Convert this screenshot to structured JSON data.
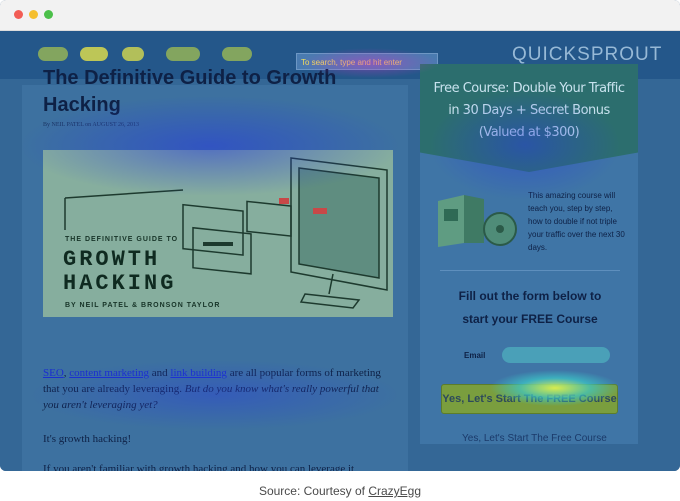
{
  "site": {
    "logo": "QUICKSPROUT",
    "search_text": "To search, type and hit enter"
  },
  "post": {
    "title": "The Definitive Guide to Growth Hacking",
    "byline": "By NEIL PATEL on AUGUST 26, 2013",
    "hero": {
      "subtitle": "THE DEFINITIVE GUIDE TO",
      "word1": "GROWTH",
      "word2": "HACKING",
      "authors": "BY NEIL PATEL & BRONSON TAYLOR"
    },
    "para1": {
      "link1": "SEO",
      "sep1": ", ",
      "link2": "content marketing",
      "sep2": " and ",
      "link3": "link building",
      "rest": " are all popular forms of marketing that you are already leveraging. ",
      "italic": "But do you know what's really powerful that you aren't leveraging yet?"
    },
    "para2": "It's growth hacking!",
    "para3": "If you aren't familiar with growth hacking and how you can leverage it"
  },
  "sidebar": {
    "banner_line1": "Free Course: Double Your Traffic",
    "banner_line2": "in 30 Days + Secret Bonus",
    "banner_line3": "(Valued at $300)",
    "course_text": "This amazing course will teach you, step by step, how to double if not triple your traffic over the next 30 days.",
    "form_head_line1": "Fill out the form below to",
    "form_head_line2": "start your FREE Course",
    "email_label": "Email",
    "cta_label": "Yes, Let's Start The FREE Course",
    "cta_link": "Yes, Let's Start The Free Course"
  },
  "caption": {
    "prefix": "Source: Courtesy of ",
    "link": "CrazyEgg"
  },
  "colors": {
    "heatmap_base": "#2f5a86",
    "heat_hot": "#d8e84a",
    "heat_warm": "#3fc0c0",
    "heat_cool": "#3a4fd8"
  }
}
